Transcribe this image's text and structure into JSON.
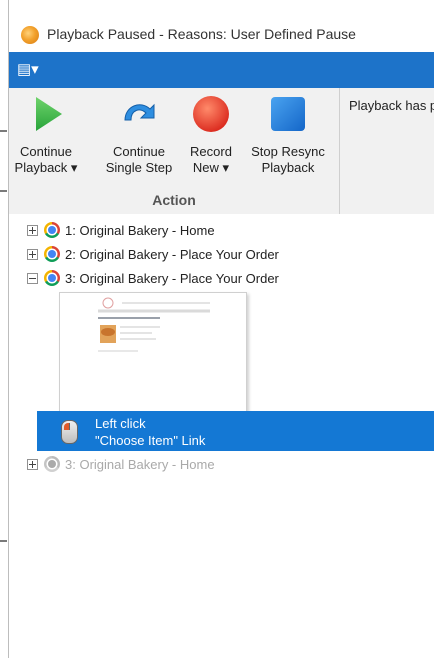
{
  "window": {
    "title": "Playback Paused - Reasons: User Defined Pause",
    "icon": "app-icon"
  },
  "menubar": {
    "menu_icon": "menu-dropdown-icon",
    "background": "#1d73c9"
  },
  "ribbon": {
    "group_label": "Action",
    "buttons": [
      {
        "line1": "Continue",
        "line2": "Playback ▾",
        "icon": "play-icon",
        "color": "#3cb44b"
      },
      {
        "line1": "Continue",
        "line2": "Single Step",
        "icon": "step-arrow-icon",
        "color": "#2e8ee0"
      },
      {
        "line1": "Record",
        "line2": "New ▾",
        "icon": "record-icon",
        "color": "#e8412a"
      },
      {
        "line1": "Stop Resync",
        "line2": "Playback",
        "icon": "stop-icon",
        "color": "#1a74d9"
      }
    ],
    "message": "Playback has p"
  },
  "tree": {
    "items": [
      {
        "label": "1: Original Bakery - Home",
        "icon": "chrome-icon",
        "expander": "plus"
      },
      {
        "label": "2: Original Bakery - Place Your Order",
        "icon": "chrome-icon",
        "expander": "plus"
      },
      {
        "label": "3: Original Bakery - Place Your Order",
        "icon": "chrome-icon",
        "expander": "minus"
      },
      {
        "label": "3: Original Bakery - Home",
        "icon": "chrome-gray-icon",
        "expander": "plus"
      }
    ],
    "selected_step": {
      "line1": "Left click",
      "line2": "\"Choose Item\" Link",
      "icon": "mouse-icon",
      "highlight": "#1478d4"
    }
  }
}
